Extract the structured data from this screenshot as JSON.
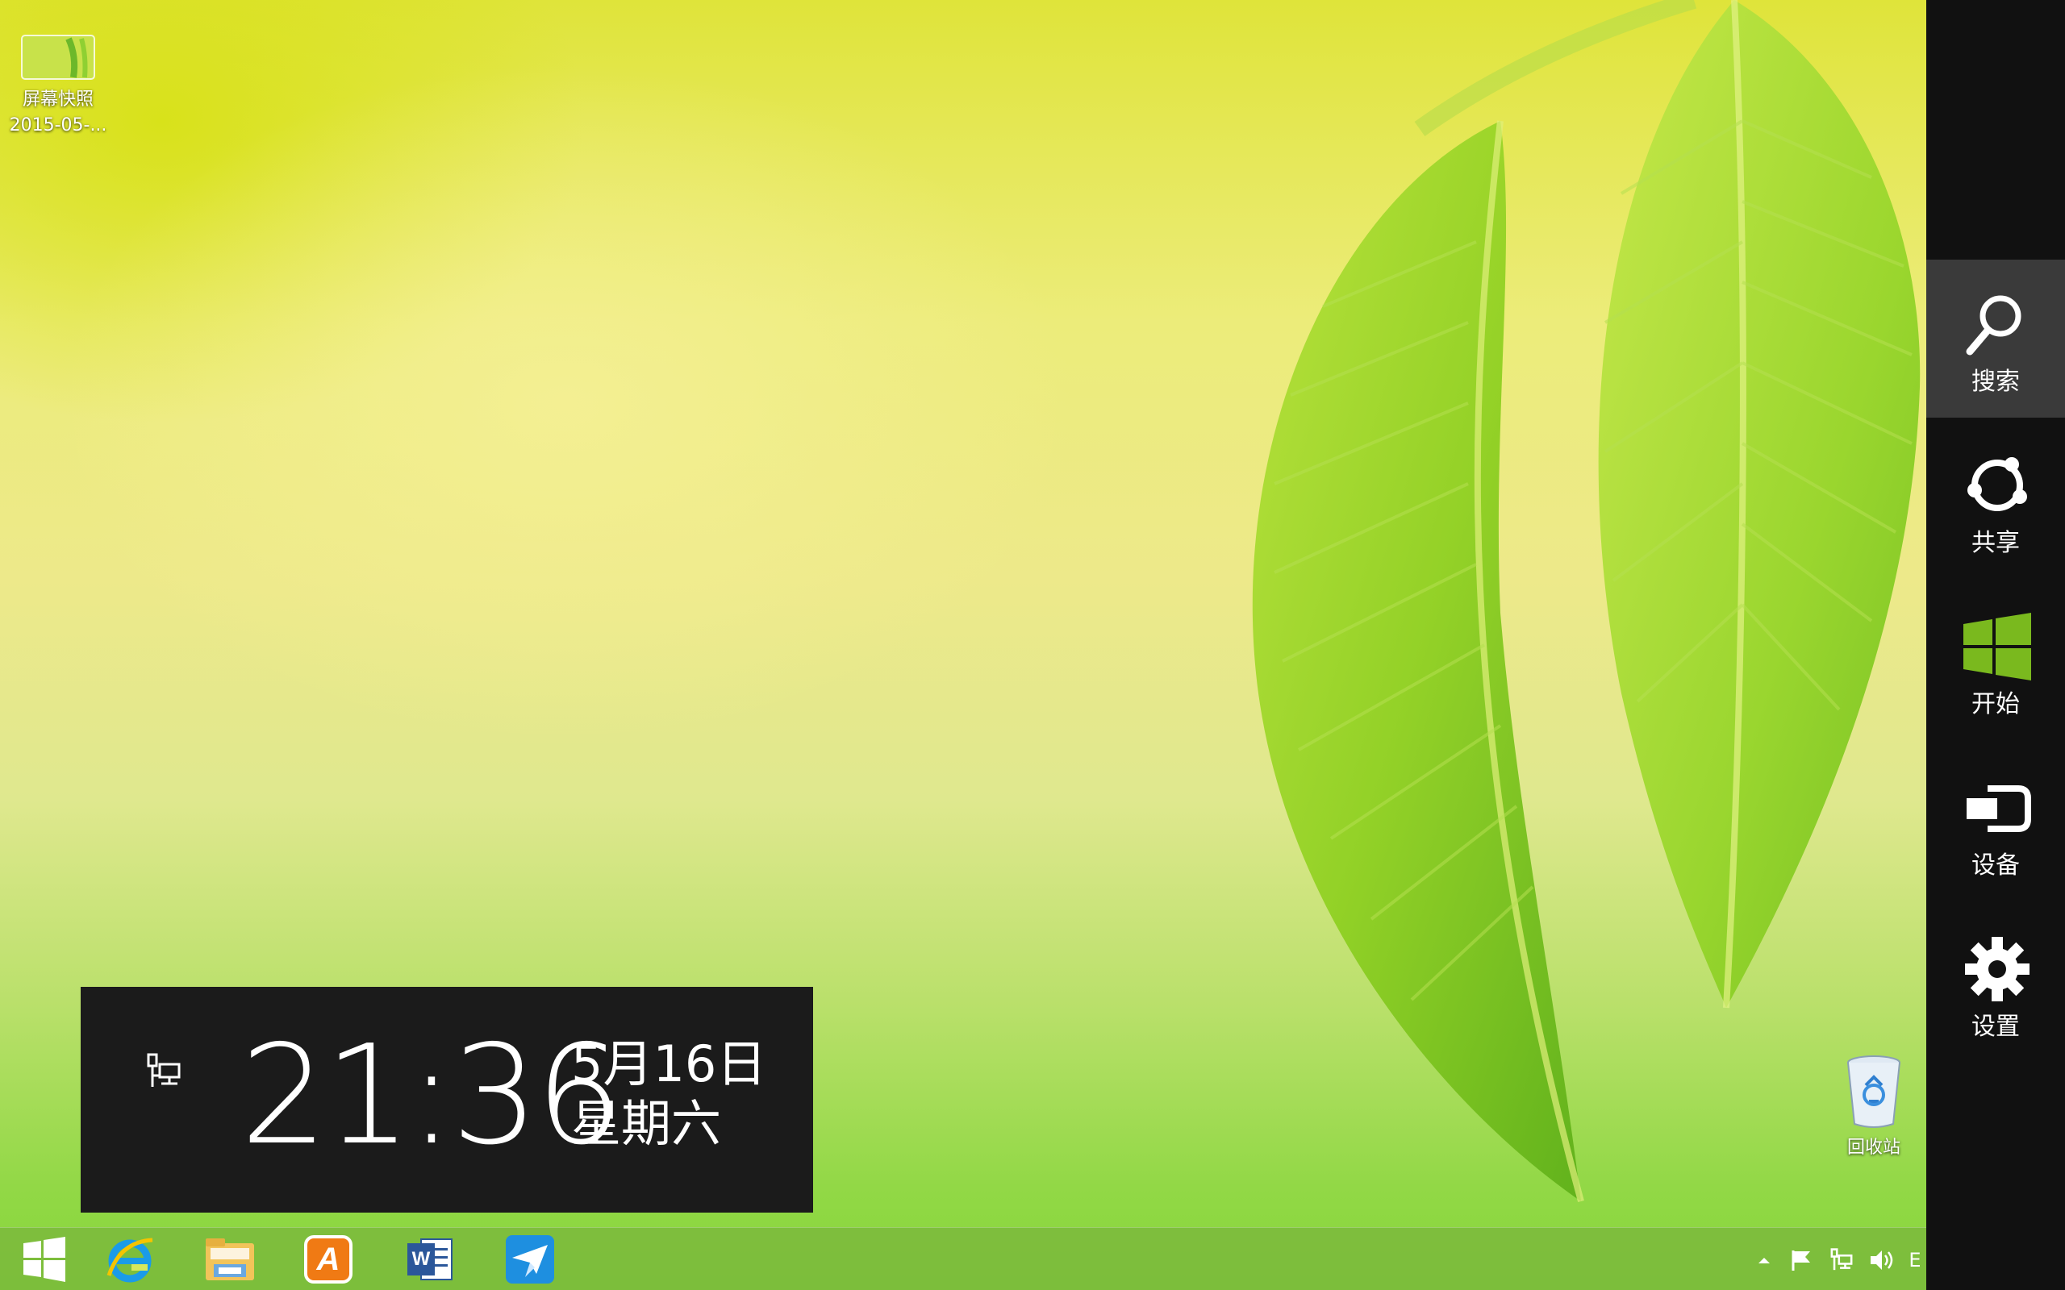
{
  "desktop": {
    "icons": [
      {
        "name": "屏幕快照 2015-05-...",
        "line1": "屏幕快照",
        "line2": "2015-05-..."
      },
      {
        "line1": "回收站"
      }
    ]
  },
  "clock": {
    "time": "21:36",
    "date": "5月16日",
    "weekday": "星期六"
  },
  "taskbar": {
    "apps": [
      "start",
      "internet-explorer",
      "file-explorer",
      "app-a",
      "word",
      "feiq"
    ],
    "app_a_letter": "A",
    "word_letter": "W",
    "tray_lang": "E"
  },
  "charms": [
    {
      "label": "搜索",
      "active": true
    },
    {
      "label": "共享"
    },
    {
      "label": "开始"
    },
    {
      "label": "设备"
    },
    {
      "label": "设置"
    }
  ],
  "colors": {
    "charm_bar": "#111111",
    "charm_active": "#3a3a3a",
    "start_green": "#7ab91e",
    "clock_panel": "#1b1b1b"
  }
}
